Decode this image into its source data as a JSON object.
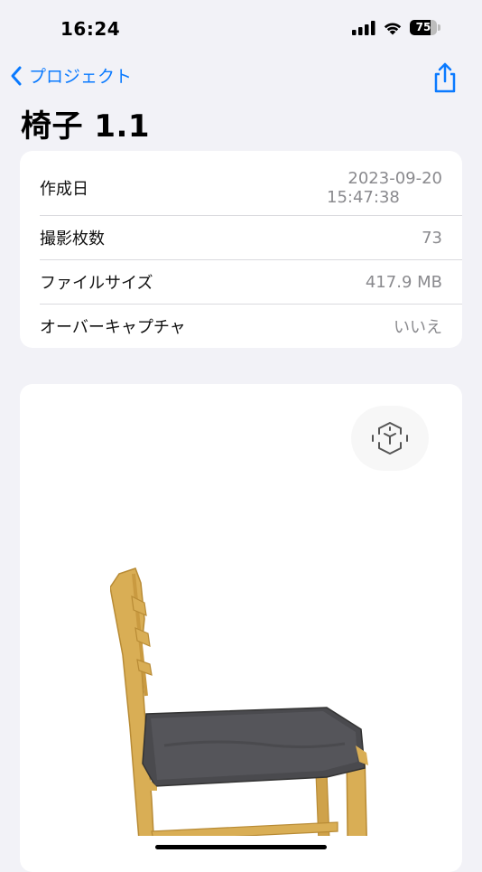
{
  "status": {
    "time": "16:24",
    "battery_level": "75"
  },
  "nav": {
    "back_label": "プロジェクト"
  },
  "title": "椅子 1.1",
  "info": {
    "rows": [
      {
        "label": "作成日",
        "value_line1": "2023-09-20",
        "value_line2": "15:47:38"
      },
      {
        "label": "撮影枚数",
        "value": "73"
      },
      {
        "label": "ファイルサイズ",
        "value": "417.9 MB"
      },
      {
        "label": "オーバーキャプチャ",
        "value": "いいえ"
      }
    ]
  },
  "colors": {
    "accent": "#0A7AFF",
    "background": "#F2F2F7",
    "card": "#FFFFFF",
    "secondary_text": "#8A8A8E"
  },
  "icons": {
    "back": "chevron-left-icon",
    "share": "share-icon",
    "ar": "ar-cube-icon"
  }
}
